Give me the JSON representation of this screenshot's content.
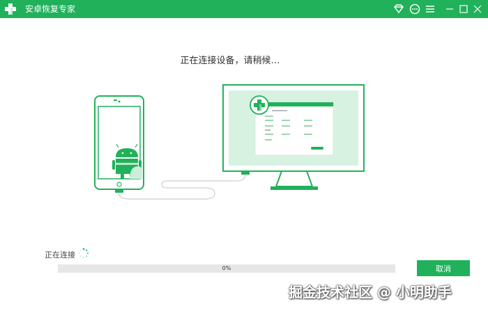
{
  "window": {
    "title": "安卓恢复专家",
    "brand_color": "#21b15a",
    "icons": [
      "diamond-icon",
      "chat-icon",
      "menu-icon",
      "minimize-icon",
      "maximize-icon",
      "close-icon"
    ]
  },
  "main": {
    "heading": "正在连接设备，请稍候…",
    "status_label": "正在连接",
    "progress": {
      "percent": 0,
      "label": "0%"
    },
    "cancel_label": "取消"
  },
  "watermark": "掘金技术社区 @ 小明助手"
}
